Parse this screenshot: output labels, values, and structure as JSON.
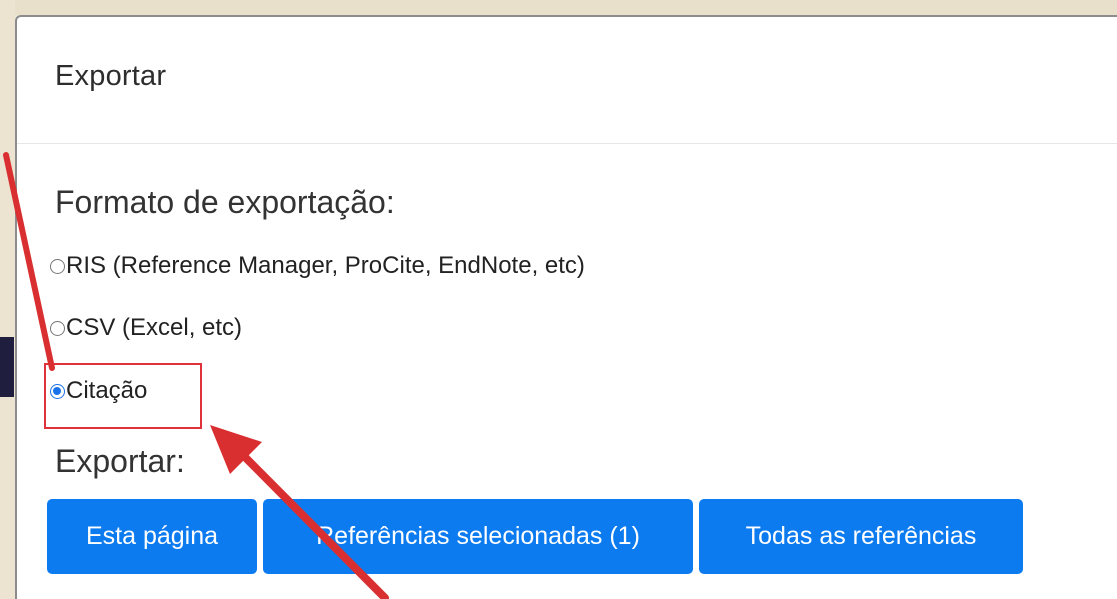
{
  "modal": {
    "title": "Exportar",
    "format_label": "Formato de exportação:",
    "options": [
      {
        "label": "RIS (Reference Manager, ProCite, EndNote, etc)",
        "checked": false
      },
      {
        "label": "CSV (Excel, etc)",
        "checked": false
      },
      {
        "label": "Citação",
        "checked": true
      }
    ],
    "export_label": "Exportar:",
    "buttons": [
      {
        "label": "Esta página"
      },
      {
        "label": "Referências selecionadas (1)"
      },
      {
        "label": "Todas as referências"
      }
    ]
  },
  "colors": {
    "button_bg": "#0d7bf0",
    "highlight": "#e0323a",
    "radio_checked": "#1a73e8"
  }
}
